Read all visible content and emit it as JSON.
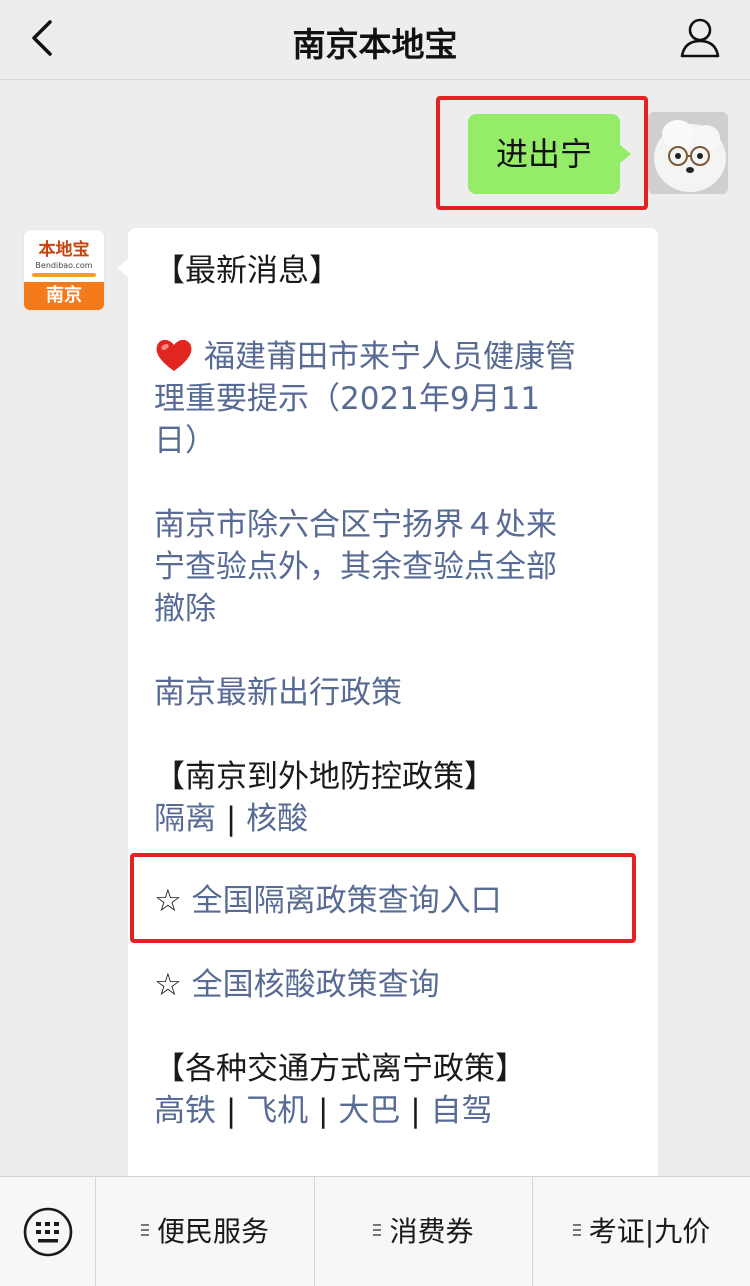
{
  "header": {
    "title": "南京本地宝"
  },
  "chat": {
    "sent_message": "进出宁",
    "bot_avatar": {
      "brand": "本地宝",
      "domain": "Bendibao.com",
      "city": "南京"
    },
    "reply": {
      "latest_heading": "【最新消息】",
      "news1_line1": "福建莆田市来宁人员健康管",
      "news1_line2": "理重要提示（2021年9月11",
      "news1_line3": "日）",
      "news2_line1": "南京市除六合区宁扬界４处来",
      "news2_line2": "宁查验点外，其余查验点全部",
      "news2_line3": "撤除",
      "news3": "南京最新出行政策",
      "policy_heading": "【南京到外地防控政策】",
      "policy_links": [
        "隔离",
        "核酸"
      ],
      "star": "☆",
      "star_item1": "全国隔离政策查询入口",
      "star_item2": "全国核酸政策查询",
      "transport_heading": "【各种交通方式离宁政策】",
      "transport_links": [
        "高铁",
        "飞机",
        "大巴",
        "自驾"
      ],
      "separator": "|"
    }
  },
  "bottom_menu": {
    "items": [
      {
        "label": "便民服务"
      },
      {
        "label": "消费券"
      },
      {
        "label": "考证|九价"
      }
    ]
  },
  "colors": {
    "link": "#576b95",
    "sent_bubble": "#95ec69",
    "highlight": "#e52222",
    "heart": "#e0261e"
  },
  "icons": [
    "back-icon",
    "profile-icon",
    "heart-icon",
    "keyboard-icon",
    "menu-lines-icon"
  ]
}
